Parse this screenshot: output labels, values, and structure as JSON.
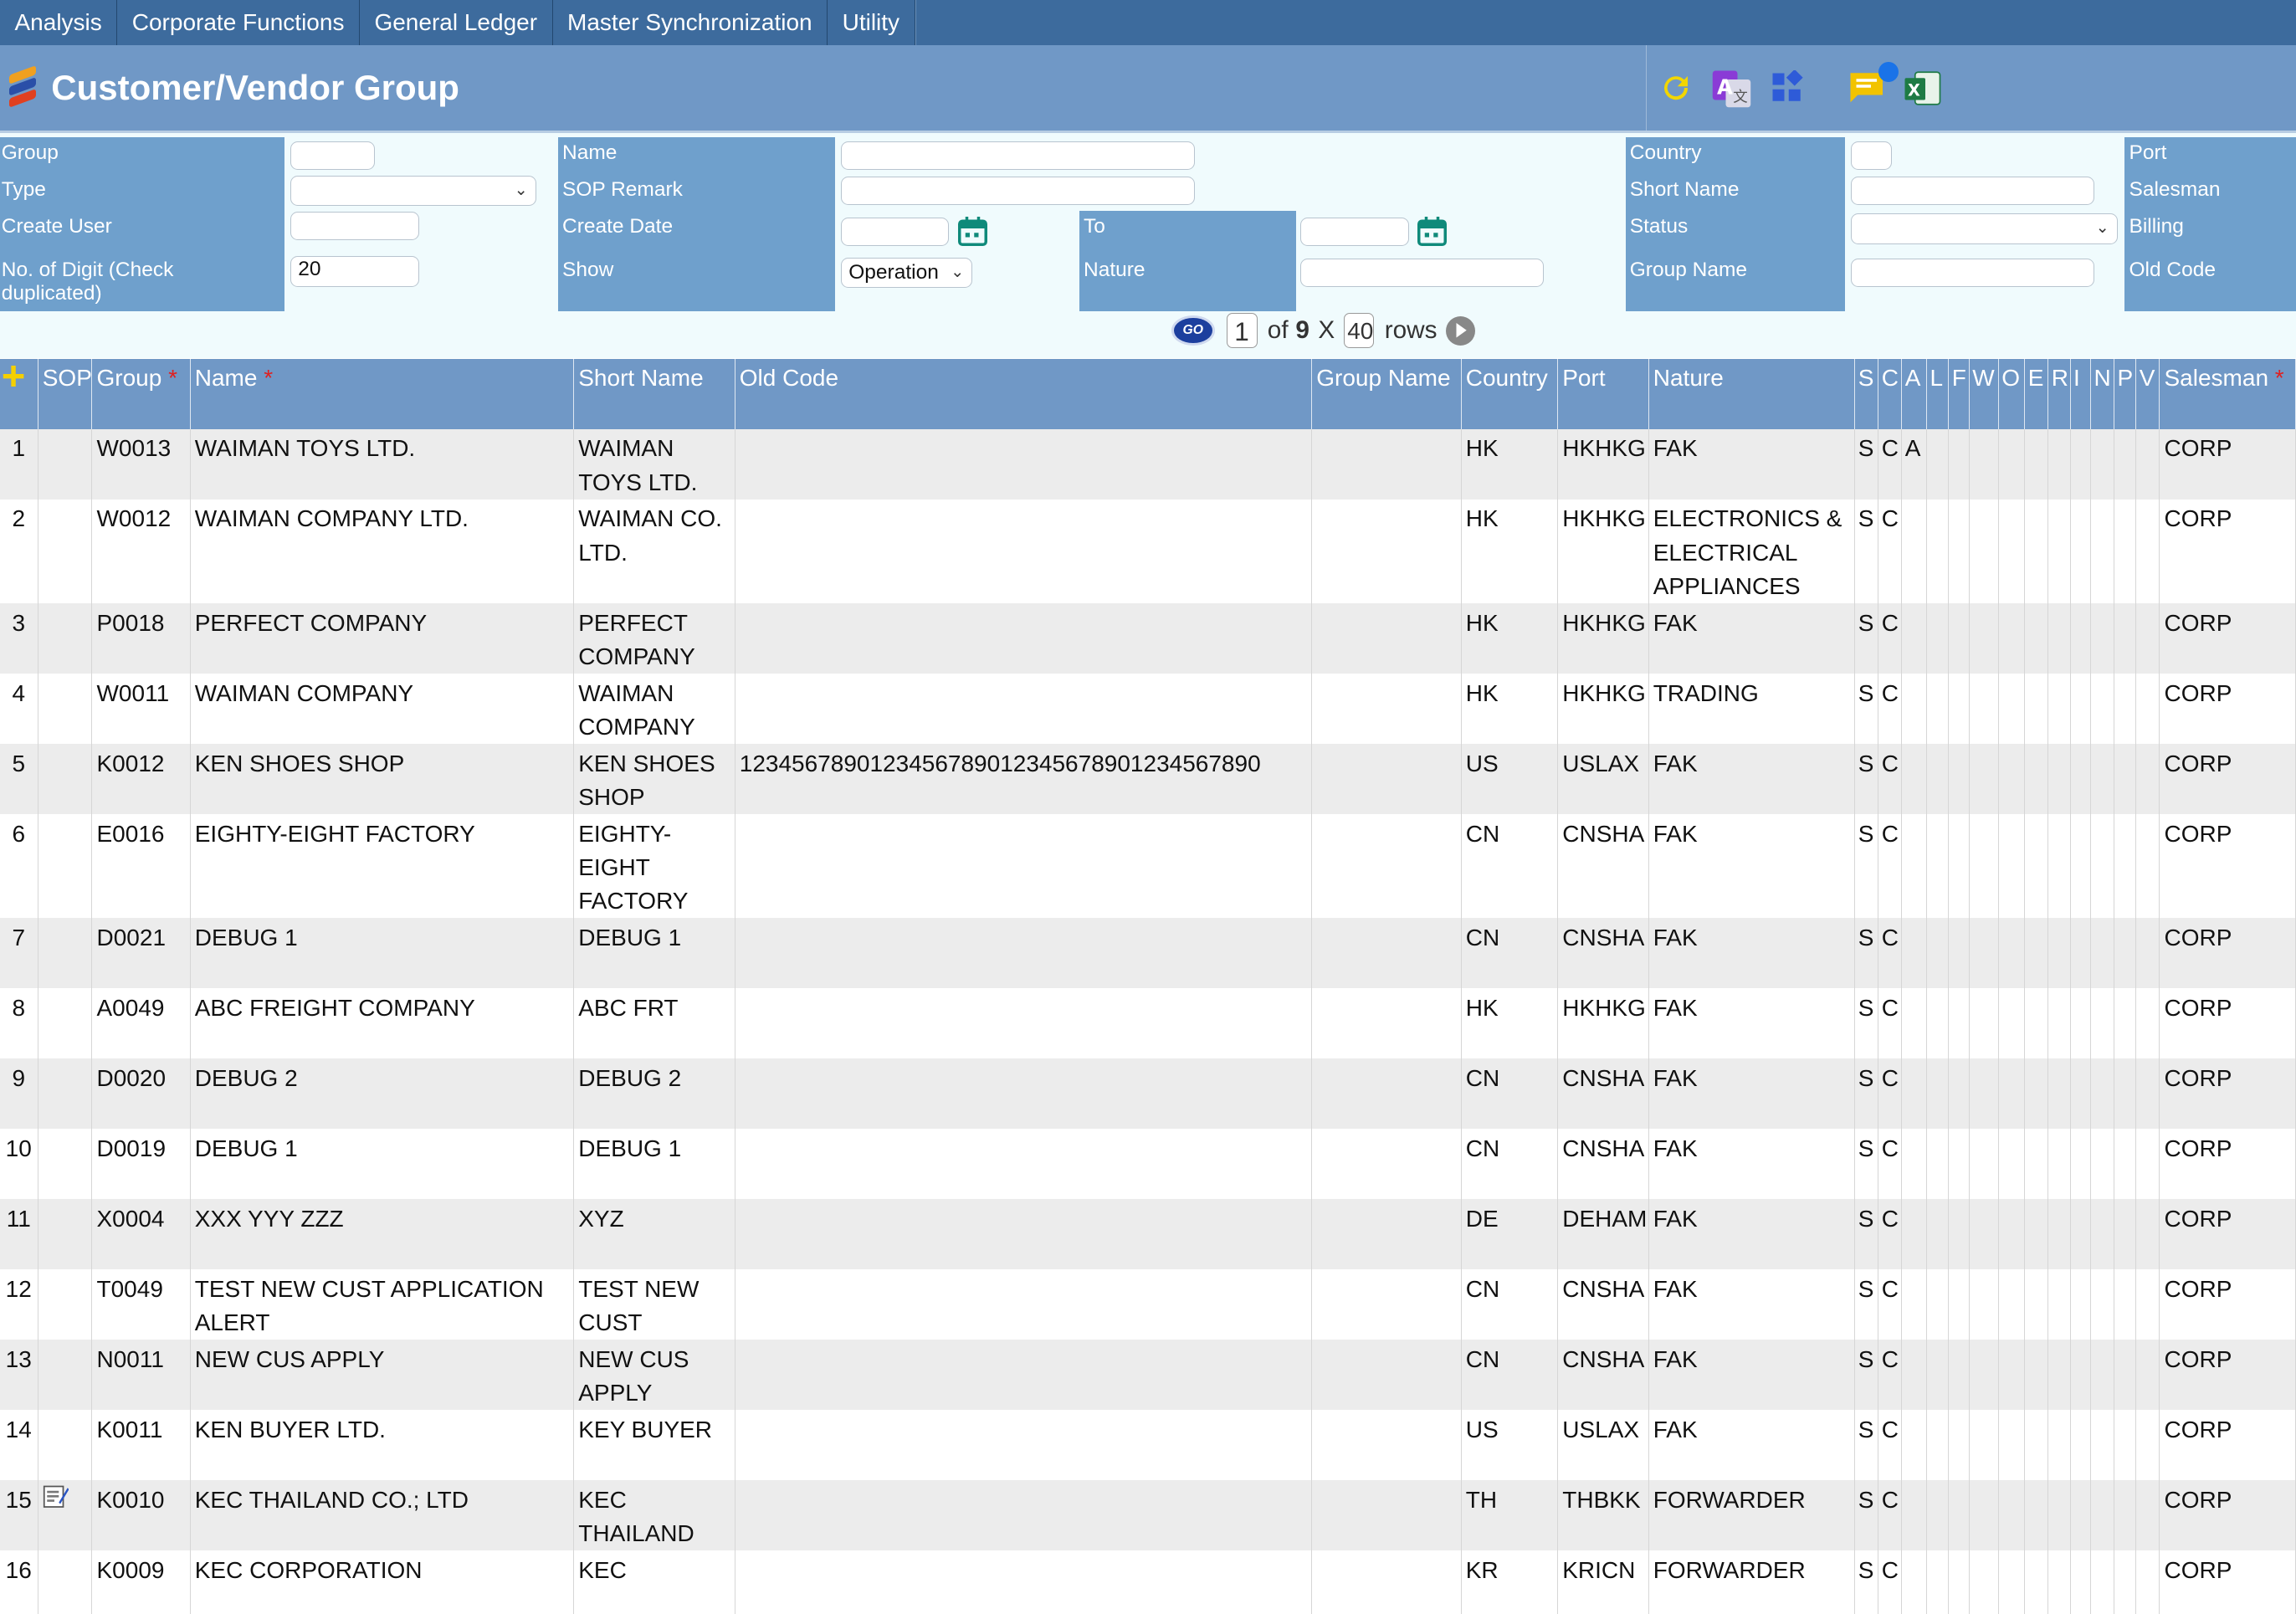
{
  "menu": [
    "Analysis",
    "Corporate Functions",
    "General Ledger",
    "Master Synchronization",
    "Utility"
  ],
  "title": "Customer/Vendor Group",
  "toolbar": [
    "refresh-icon",
    "translate-icon",
    "widgets-icon",
    "comment-icon",
    "excel-icon"
  ],
  "filters": {
    "group": "Group",
    "type": "Type",
    "create_user": "Create User",
    "digit": "No. of Digit (Check duplicated)",
    "digit_value": "20",
    "name": "Name",
    "sop_remark": "SOP Remark",
    "create_date": "Create Date",
    "show": "Show",
    "show_value": "Operation",
    "to": "To",
    "nature": "Nature",
    "country": "Country",
    "short_name": "Short Name",
    "status": "Status",
    "group_name": "Group Name",
    "port": "Port",
    "salesman": "Salesman",
    "billing": "Billing",
    "old_code": "Old Code"
  },
  "pager": {
    "page": "1",
    "of": "of",
    "total": "9",
    "x": "X",
    "rows_value": "40",
    "rows": "rows"
  },
  "columns": [
    {
      "label": "SOP",
      "req": false
    },
    {
      "label": "Group",
      "req": true
    },
    {
      "label": "Name",
      "req": true
    },
    {
      "label": "Short Name",
      "req": false
    },
    {
      "label": "Old Code",
      "req": false
    },
    {
      "label": "Group Name",
      "req": false
    },
    {
      "label": "Country",
      "req": false
    },
    {
      "label": "Port",
      "req": false
    },
    {
      "label": "Nature",
      "req": false
    },
    {
      "label": "S",
      "req": false
    },
    {
      "label": "C",
      "req": false
    },
    {
      "label": "A",
      "req": false
    },
    {
      "label": "L",
      "req": false
    },
    {
      "label": "F",
      "req": false
    },
    {
      "label": "W",
      "req": false
    },
    {
      "label": "O",
      "req": false
    },
    {
      "label": "E",
      "req": false
    },
    {
      "label": "R",
      "req": false
    },
    {
      "label": "I",
      "req": false
    },
    {
      "label": "N",
      "req": false
    },
    {
      "label": "P",
      "req": false
    },
    {
      "label": "V",
      "req": false
    },
    {
      "label": "Salesman",
      "req": true
    }
  ],
  "rows": [
    {
      "no": "1",
      "sop": "",
      "group": "W0013",
      "name": "WAIMAN TOYS LTD.",
      "short": "WAIMAN TOYS LTD.",
      "old": "",
      "gname": "",
      "country": "HK",
      "port": "HKHKG",
      "nature": "FAK",
      "s": "S",
      "c": "C",
      "a": "A",
      "salesman": "CORP"
    },
    {
      "no": "2",
      "sop": "",
      "group": "W0012",
      "name": "WAIMAN COMPANY LTD.",
      "short": "WAIMAN CO. LTD.",
      "old": "",
      "gname": "",
      "country": "HK",
      "port": "HKHKG",
      "nature": "ELECTRONICS & ELECTRICAL APPLIANCES",
      "s": "S",
      "c": "C",
      "a": "",
      "salesman": "CORP"
    },
    {
      "no": "3",
      "sop": "",
      "group": "P0018",
      "name": "PERFECT COMPANY",
      "short": "PERFECT COMPANY",
      "old": "",
      "gname": "",
      "country": "HK",
      "port": "HKHKG",
      "nature": "FAK",
      "s": "S",
      "c": "C",
      "a": "",
      "salesman": "CORP"
    },
    {
      "no": "4",
      "sop": "",
      "group": "W0011",
      "name": "WAIMAN COMPANY",
      "short": "WAIMAN COMPANY",
      "old": "",
      "gname": "",
      "country": "HK",
      "port": "HKHKG",
      "nature": "TRADING",
      "s": "S",
      "c": "C",
      "a": "",
      "salesman": "CORP"
    },
    {
      "no": "5",
      "sop": "",
      "group": "K0012",
      "name": "KEN SHOES SHOP",
      "short": "KEN SHOES SHOP",
      "old": "1234567890123456789012345678901234567890",
      "gname": "",
      "country": "US",
      "port": "USLAX",
      "nature": "FAK",
      "s": "S",
      "c": "C",
      "a": "",
      "salesman": "CORP"
    },
    {
      "no": "6",
      "sop": "",
      "group": "E0016",
      "name": "EIGHTY-EIGHT FACTORY",
      "short": "EIGHTY-EIGHT FACTORY",
      "old": "",
      "gname": "",
      "country": "CN",
      "port": "CNSHA",
      "nature": "FAK",
      "s": "S",
      "c": "C",
      "a": "",
      "salesman": "CORP"
    },
    {
      "no": "7",
      "sop": "",
      "group": "D0021",
      "name": "DEBUG 1",
      "short": "DEBUG 1",
      "old": "",
      "gname": "",
      "country": "CN",
      "port": "CNSHA",
      "nature": "FAK",
      "s": "S",
      "c": "C",
      "a": "",
      "salesman": "CORP"
    },
    {
      "no": "8",
      "sop": "",
      "group": "A0049",
      "name": "ABC FREIGHT COMPANY",
      "short": "ABC FRT",
      "old": "",
      "gname": "",
      "country": "HK",
      "port": "HKHKG",
      "nature": "FAK",
      "s": "S",
      "c": "C",
      "a": "",
      "salesman": "CORP"
    },
    {
      "no": "9",
      "sop": "",
      "group": "D0020",
      "name": "DEBUG 2",
      "short": "DEBUG 2",
      "old": "",
      "gname": "",
      "country": "CN",
      "port": "CNSHA",
      "nature": "FAK",
      "s": "S",
      "c": "C",
      "a": "",
      "salesman": "CORP"
    },
    {
      "no": "10",
      "sop": "",
      "group": "D0019",
      "name": "DEBUG 1",
      "short": "DEBUG 1",
      "old": "",
      "gname": "",
      "country": "CN",
      "port": "CNSHA",
      "nature": "FAK",
      "s": "S",
      "c": "C",
      "a": "",
      "salesman": "CORP"
    },
    {
      "no": "11",
      "sop": "",
      "group": "X0004",
      "name": "XXX YYY ZZZ",
      "short": "XYZ",
      "old": "",
      "gname": "",
      "country": "DE",
      "port": "DEHAM",
      "nature": "FAK",
      "s": "S",
      "c": "C",
      "a": "",
      "salesman": "CORP"
    },
    {
      "no": "12",
      "sop": "",
      "group": "T0049",
      "name": "TEST NEW CUST APPLICATION ALERT",
      "short": "TEST NEW CUST",
      "old": "",
      "gname": "",
      "country": "CN",
      "port": "CNSHA",
      "nature": "FAK",
      "s": "S",
      "c": "C",
      "a": "",
      "salesman": "CORP"
    },
    {
      "no": "13",
      "sop": "",
      "group": "N0011",
      "name": "NEW CUS APPLY",
      "short": "NEW CUS APPLY",
      "old": "",
      "gname": "",
      "country": "CN",
      "port": "CNSHA",
      "nature": "FAK",
      "s": "S",
      "c": "C",
      "a": "",
      "salesman": "CORP"
    },
    {
      "no": "14",
      "sop": "",
      "group": "K0011",
      "name": "KEN BUYER LTD.",
      "short": "KEY BUYER",
      "old": "",
      "gname": "",
      "country": "US",
      "port": "USLAX",
      "nature": "FAK",
      "s": "S",
      "c": "C",
      "a": "",
      "salesman": "CORP"
    },
    {
      "no": "15",
      "sop": "edit-note-icon",
      "group": "K0010",
      "name": "KEC THAILAND CO.; LTD",
      "short": "KEC THAILAND",
      "old": "",
      "gname": "",
      "country": "TH",
      "port": "THBKK",
      "nature": "FORWARDER",
      "s": "S",
      "c": "C",
      "a": "",
      "salesman": "CORP"
    },
    {
      "no": "16",
      "sop": "",
      "group": "K0009",
      "name": "KEC CORPORATION",
      "short": "KEC",
      "old": "",
      "gname": "",
      "country": "KR",
      "port": "KRICN",
      "nature": "FORWARDER",
      "s": "S",
      "c": "C",
      "a": "",
      "salesman": "CORP"
    }
  ],
  "colors": {
    "menu": "#3d6b9d",
    "title": "#7098c6",
    "label_bg": "#6fa0cc",
    "filter_bg": "#f0fbfd",
    "row_alt": "#ececec",
    "required": "#e02020"
  }
}
